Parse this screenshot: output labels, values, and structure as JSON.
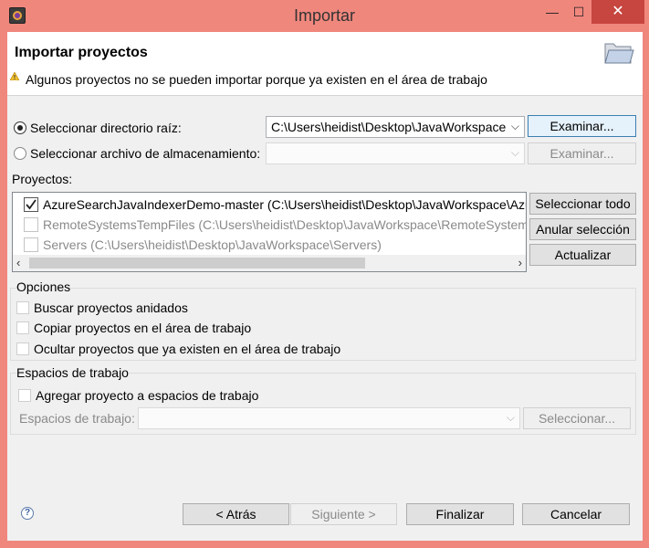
{
  "window": {
    "title": "Importar",
    "minimize": "—",
    "maximize": "☐",
    "close": "✕"
  },
  "header": {
    "title": "Importar proyectos",
    "warning": "Algunos proyectos no se pueden importar porque ya existen en el área de trabajo"
  },
  "source": {
    "dir_radio_label": "Seleccionar directorio raíz:",
    "dir_value": "C:\\Users\\heidist\\Desktop\\JavaWorkspace",
    "browse_label": "Examinar...",
    "archive_radio_label": "Seleccionar archivo de almacenamiento:",
    "archive_value": "",
    "archive_browse_label": "Examinar..."
  },
  "projects": {
    "label": "Proyectos:",
    "items": [
      {
        "text": "AzureSearchJavaIndexerDemo-master (C:\\Users\\heidist\\Desktop\\JavaWorkspace\\AzureSearchJavaIndexerDemo-master)",
        "checked": true,
        "enabled": true
      },
      {
        "text": "RemoteSystemsTempFiles (C:\\Users\\heidist\\Desktop\\JavaWorkspace\\RemoteSystemsTempFiles)",
        "checked": false,
        "enabled": false
      },
      {
        "text": "Servers (C:\\Users\\heidist\\Desktop\\JavaWorkspace\\Servers)",
        "checked": false,
        "enabled": false
      }
    ],
    "select_all": "Seleccionar todo",
    "deselect_all": "Anular selección",
    "refresh": "Actualizar"
  },
  "options": {
    "title": "Opciones",
    "nested": "Buscar proyectos anidados",
    "copy": "Copiar proyectos en el área de trabajo",
    "hide": "Ocultar proyectos que ya existen en el área de trabajo"
  },
  "workingsets": {
    "title": "Espacios de trabajo",
    "add": "Agregar proyecto a espacios de trabajo",
    "label": "Espacios de trabajo:",
    "value": "",
    "select": "Seleccionar..."
  },
  "footer": {
    "help": "?",
    "back": "< Atrás",
    "next": "Siguiente >",
    "finish": "Finalizar",
    "cancel": "Cancelar"
  }
}
